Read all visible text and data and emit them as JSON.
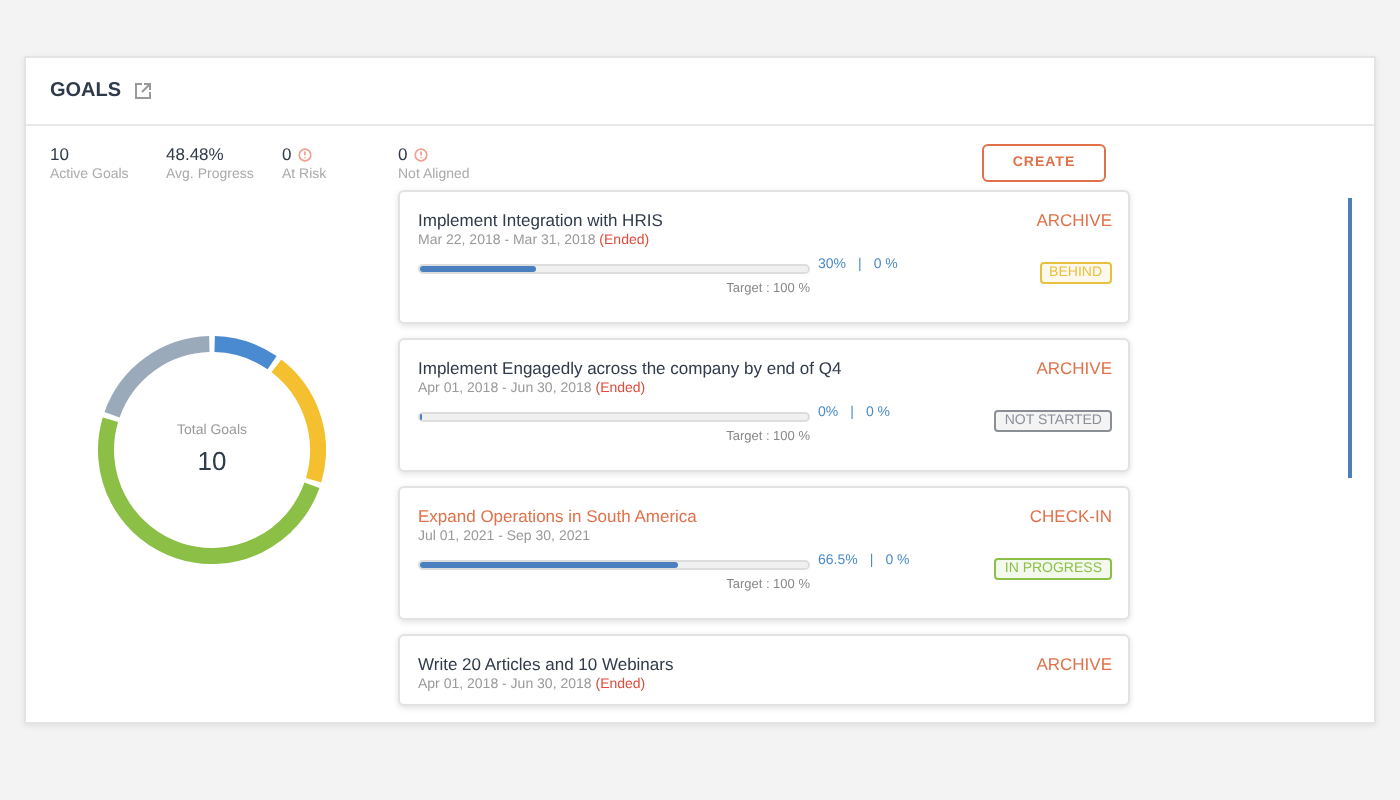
{
  "panel": {
    "title": "GOALS"
  },
  "stats": [
    {
      "value": "10",
      "label": "Active Goals",
      "alert": false
    },
    {
      "value": "48.48%",
      "label": "Avg. Progress",
      "alert": false
    },
    {
      "value": "0",
      "label": "At Risk",
      "alert": true
    },
    {
      "value": "0",
      "label": "Not Aligned",
      "alert": true
    }
  ],
  "create_button": "CREATE",
  "donut": {
    "label": "Total Goals",
    "total": "10"
  },
  "goals": [
    {
      "kind": "ended",
      "title": "Implement Integration with HRIS",
      "dates": "Mar 22, 2018 - Mar 31, 2018",
      "note": "(Ended)",
      "action": "ARCHIVE",
      "level": 0.3,
      "progress": "30%",
      "separator": "|",
      "change": "0 %",
      "target": "Target : 100 %",
      "status": "BEHIND",
      "color": "#e8c040"
    },
    {
      "kind": "ended",
      "title": "Implement Engagedly across the company by end of Q4",
      "dates": "Apr 01, 2018 - Jun 30, 2018",
      "note": "(Ended)",
      "action": "ARCHIVE",
      "level": 0,
      "progress": "0%",
      "separator": "|",
      "change": "0 %",
      "target": "Target : 100 %",
      "status": "NOT STARTED",
      "color": "#8a8f96"
    },
    {
      "kind": "current",
      "title": "Expand Operations in South America",
      "dates": "Jul 01, 2021 - Sep 30, 2021",
      "action": "CHECK-IN",
      "level": 0.665,
      "progress": "66.5%",
      "separator": "|",
      "change": "0 %",
      "target": "Target : 100 %",
      "status": "IN PROGRESS",
      "color": "#8cbf45"
    },
    {
      "kind": "ended",
      "title": "Write 20 Articles and 10 Webinars",
      "dates": "Apr 01, 2018 - Jun 30, 2018",
      "note": "(Ended)",
      "action": "ARCHIVE"
    }
  ]
}
